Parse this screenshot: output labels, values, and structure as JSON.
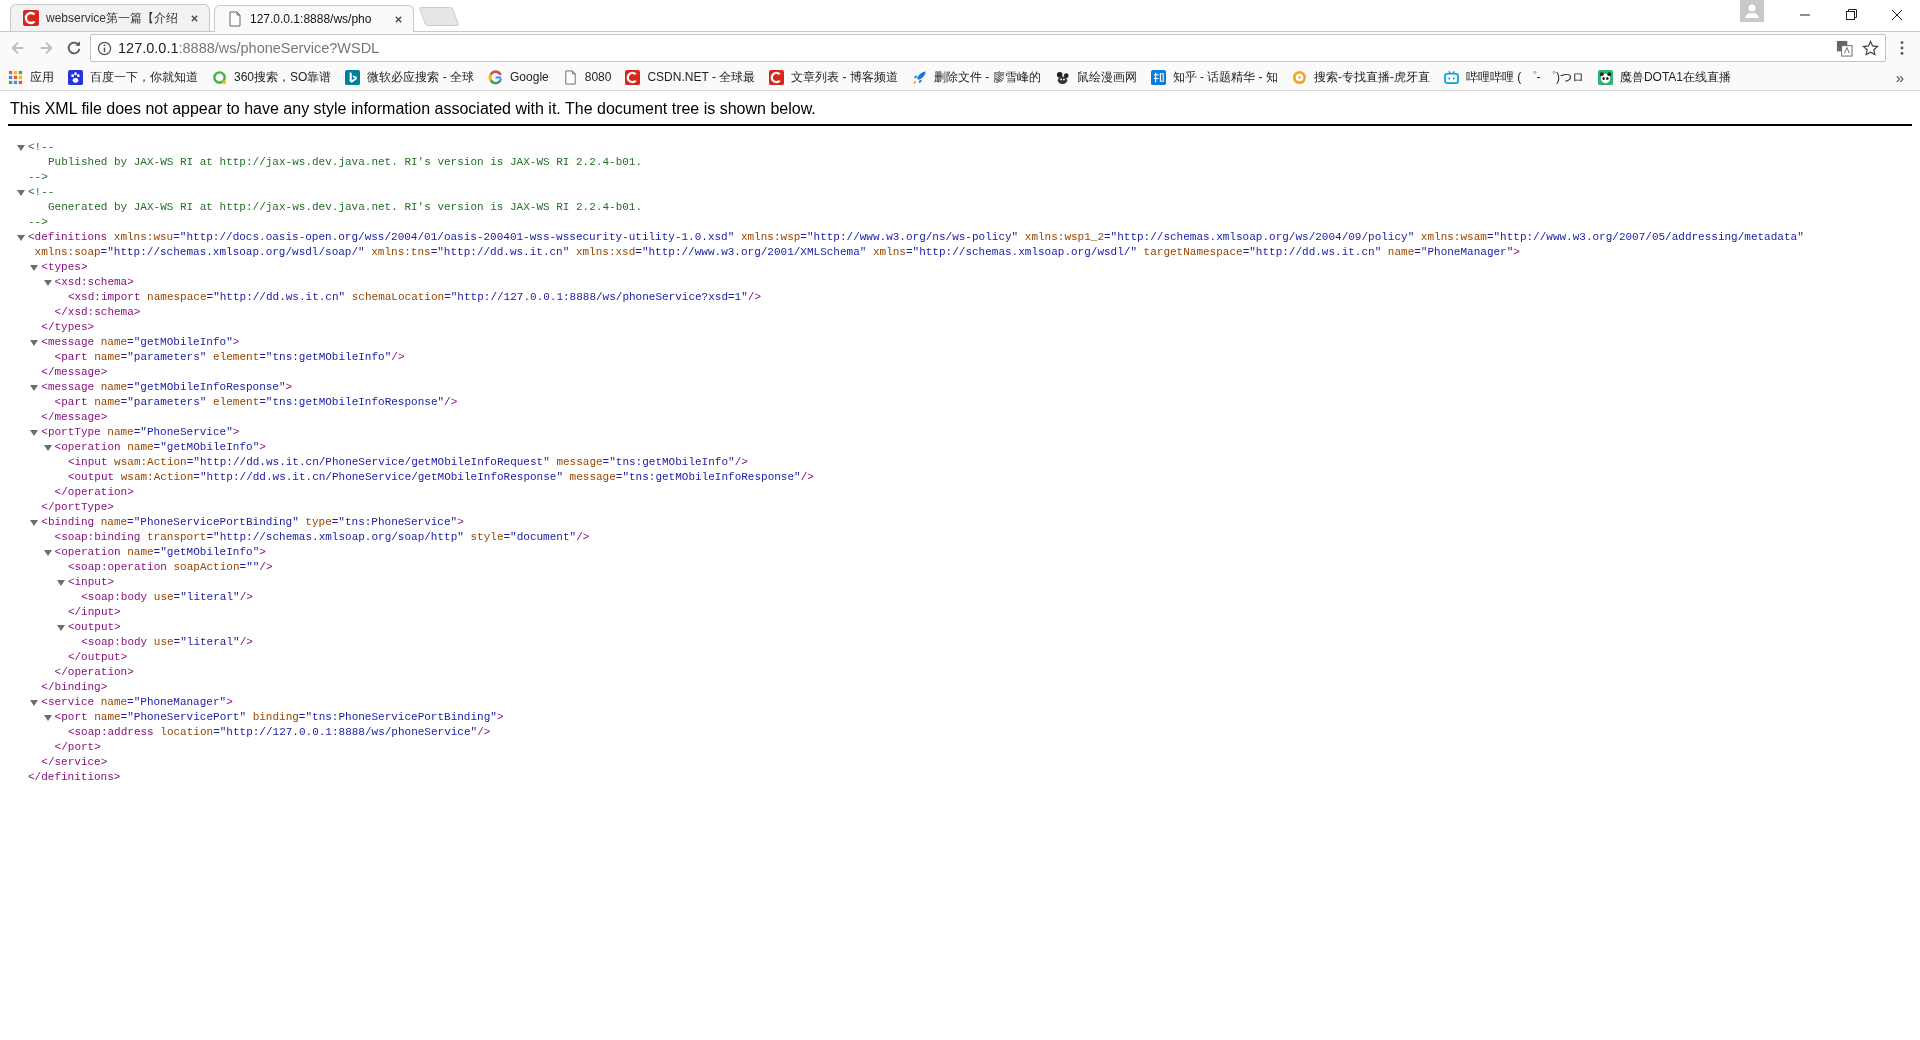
{
  "tabs": [
    {
      "title": "webservice第一篇【介绍",
      "selected": false
    },
    {
      "title": "127.0.0.1:8888/ws/pho",
      "selected": true
    }
  ],
  "address": {
    "host": "127.0.0.1",
    "rest": ":8888/ws/phoneService?WSDL"
  },
  "bookmarks": [
    {
      "label": "应用"
    },
    {
      "label": "百度一下，你就知道"
    },
    {
      "label": "360搜索，SO靠谱"
    },
    {
      "label": "微软必应搜索 - 全球"
    },
    {
      "label": "Google"
    },
    {
      "label": "8080"
    },
    {
      "label": "CSDN.NET - 全球最"
    },
    {
      "label": "文章列表 - 博客频道"
    },
    {
      "label": "删除文件 - 廖雪峰的"
    },
    {
      "label": "鼠绘漫画网"
    },
    {
      "label": "知乎 - 话题精华 - 知"
    },
    {
      "label": "搜索-专找直播-虎牙直"
    },
    {
      "label": "哔哩哔哩 ( ゜- ゜)つロ"
    },
    {
      "label": "魔兽DOTA1在线直播"
    }
  ],
  "more_bookmarks": "»",
  "notice": "This XML file does not appear to have any style information associated with it. The document tree is shown below.",
  "tree": [
    {
      "kind": "comment",
      "expanded": true,
      "open": "<!--",
      "text": "Published by JAX-WS RI at http://jax-ws.dev.java.net. RI's version is JAX-WS RI 2.2.4-b01.",
      "close": "-->"
    },
    {
      "kind": "comment",
      "expanded": true,
      "open": "<!--",
      "text": "Generated by JAX-WS RI at http://jax-ws.dev.java.net. RI's version is JAX-WS RI 2.2.4-b01.",
      "close": "-->"
    },
    {
      "kind": "element",
      "expanded": true,
      "tag": "<definitions",
      "attrs": [
        {
          "name": "xmlns:wsu",
          "value": "=\"http://docs.oasis-open.org/wss/2004/01/oasis-200401-wss-wssecurity-utility-1.0.xsd\""
        },
        {
          "name": "xmlns:wsp",
          "value": "=\"http://www.w3.org/ns/ws-policy\""
        },
        {
          "name": "xmlns:wsp1_2",
          "value": "=\"http://schemas.xmlsoap.org/ws/2004/09/policy\""
        },
        {
          "name": "xmlns:wsam",
          "value": "=\"http://www.w3.org/2007/05/addressing/metadata\""
        },
        {
          "name": "xmlns:soap",
          "value": "=\"http://schemas.xmlsoap.org/wsdl/soap/\""
        },
        {
          "name": "xmlns:tns",
          "value": "=\"http://dd.ws.it.cn\""
        },
        {
          "name": "xmlns:xsd",
          "value": "=\"http://www.w3.org/2001/XMLSchema\""
        },
        {
          "name": "xmlns",
          "value": "=\"http://schemas.xmlsoap.org/wsdl/\""
        },
        {
          "name": "targetNamespace",
          "value": "=\"http://dd.ws.it.cn\""
        },
        {
          "name": "name",
          "value": "=\"PhoneManager\""
        }
      ],
      "end": ">",
      "close": "</definitions>",
      "children": [
        {
          "kind": "element",
          "expanded": true,
          "tag": "<types",
          "end": ">",
          "close": "</types>",
          "children": [
            {
              "kind": "element",
              "expanded": true,
              "tag": "<xsd:schema",
              "end": ">",
              "close": "</xsd:schema>",
              "children": [
                {
                  "kind": "leaf",
                  "tag": "<xsd:import",
                  "attrs": [
                    {
                      "name": "namespace",
                      "value": "=\"http://dd.ws.it.cn\""
                    },
                    {
                      "name": "schemaLocation",
                      "value": "=\"http://127.0.0.1:8888/ws/phoneService?xsd=1\""
                    }
                  ],
                  "end": "/>"
                }
              ]
            }
          ]
        },
        {
          "kind": "element",
          "expanded": true,
          "tag": "<message",
          "attrs": [
            {
              "name": "name",
              "value": "=\"getMObileInfo\""
            }
          ],
          "end": ">",
          "close": "</message>",
          "children": [
            {
              "kind": "leaf",
              "tag": "<part",
              "attrs": [
                {
                  "name": "name",
                  "value": "=\"parameters\""
                },
                {
                  "name": "element",
                  "value": "=\"tns:getMObileInfo\""
                }
              ],
              "end": "/>"
            }
          ]
        },
        {
          "kind": "element",
          "expanded": true,
          "tag": "<message",
          "attrs": [
            {
              "name": "name",
              "value": "=\"getMObileInfoResponse\""
            }
          ],
          "end": ">",
          "close": "</message>",
          "children": [
            {
              "kind": "leaf",
              "tag": "<part",
              "attrs": [
                {
                  "name": "name",
                  "value": "=\"parameters\""
                },
                {
                  "name": "element",
                  "value": "=\"tns:getMObileInfoResponse\""
                }
              ],
              "end": "/>"
            }
          ]
        },
        {
          "kind": "element",
          "expanded": true,
          "tag": "<portType",
          "attrs": [
            {
              "name": "name",
              "value": "=\"PhoneService\""
            }
          ],
          "end": ">",
          "close": "</portType>",
          "children": [
            {
              "kind": "element",
              "expanded": true,
              "tag": "<operation",
              "attrs": [
                {
                  "name": "name",
                  "value": "=\"getMObileInfo\""
                }
              ],
              "end": ">",
              "close": "</operation>",
              "children": [
                {
                  "kind": "leaf",
                  "tag": "<input",
                  "attrs": [
                    {
                      "name": "wsam:Action",
                      "value": "=\"http://dd.ws.it.cn/PhoneService/getMObileInfoRequest\""
                    },
                    {
                      "name": "message",
                      "value": "=\"tns:getMObileInfo\""
                    }
                  ],
                  "end": "/>"
                },
                {
                  "kind": "leaf",
                  "tag": "<output",
                  "attrs": [
                    {
                      "name": "wsam:Action",
                      "value": "=\"http://dd.ws.it.cn/PhoneService/getMObileInfoResponse\""
                    },
                    {
                      "name": "message",
                      "value": "=\"tns:getMObileInfoResponse\""
                    }
                  ],
                  "end": "/>"
                }
              ]
            }
          ]
        },
        {
          "kind": "element",
          "expanded": true,
          "tag": "<binding",
          "attrs": [
            {
              "name": "name",
              "value": "=\"PhoneServicePortBinding\""
            },
            {
              "name": "type",
              "value": "=\"tns:PhoneService\""
            }
          ],
          "end": ">",
          "close": "</binding>",
          "children": [
            {
              "kind": "leaf",
              "tag": "<soap:binding",
              "attrs": [
                {
                  "name": "transport",
                  "value": "=\"http://schemas.xmlsoap.org/soap/http\""
                },
                {
                  "name": "style",
                  "value": "=\"document\""
                }
              ],
              "end": "/>"
            },
            {
              "kind": "element",
              "expanded": true,
              "tag": "<operation",
              "attrs": [
                {
                  "name": "name",
                  "value": "=\"getMObileInfo\""
                }
              ],
              "end": ">",
              "close": "</operation>",
              "children": [
                {
                  "kind": "leaf",
                  "tag": "<soap:operation",
                  "attrs": [
                    {
                      "name": "soapAction",
                      "value": "=\"\""
                    }
                  ],
                  "end": "/>"
                },
                {
                  "kind": "element",
                  "expanded": true,
                  "tag": "<input",
                  "end": ">",
                  "close": "</input>",
                  "children": [
                    {
                      "kind": "leaf",
                      "tag": "<soap:body",
                      "attrs": [
                        {
                          "name": "use",
                          "value": "=\"literal\""
                        }
                      ],
                      "end": "/>"
                    }
                  ]
                },
                {
                  "kind": "element",
                  "expanded": true,
                  "tag": "<output",
                  "end": ">",
                  "close": "</output>",
                  "children": [
                    {
                      "kind": "leaf",
                      "tag": "<soap:body",
                      "attrs": [
                        {
                          "name": "use",
                          "value": "=\"literal\""
                        }
                      ],
                      "end": "/>"
                    }
                  ]
                }
              ]
            }
          ]
        },
        {
          "kind": "element",
          "expanded": true,
          "tag": "<service",
          "attrs": [
            {
              "name": "name",
              "value": "=\"PhoneManager\""
            }
          ],
          "end": ">",
          "close": "</service>",
          "children": [
            {
              "kind": "element",
              "expanded": true,
              "tag": "<port",
              "attrs": [
                {
                  "name": "name",
                  "value": "=\"PhoneServicePort\""
                },
                {
                  "name": "binding",
                  "value": "=\"tns:PhoneServicePortBinding\""
                }
              ],
              "end": ">",
              "close": "</port>",
              "children": [
                {
                  "kind": "leaf",
                  "tag": "<soap:address",
                  "attrs": [
                    {
                      "name": "location",
                      "value": "=\"http://127.0.0.1:8888/ws/phoneService\""
                    }
                  ],
                  "end": "/>"
                }
              ]
            }
          ]
        }
      ]
    }
  ]
}
